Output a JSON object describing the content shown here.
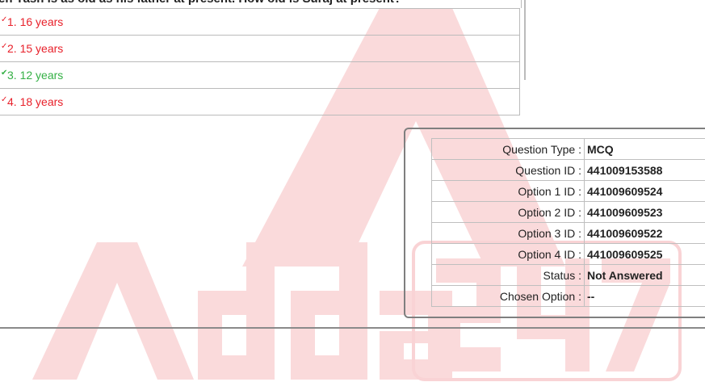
{
  "question": {
    "text": "en Yash is as old as his father at present. How old is Suraj at present?"
  },
  "options": [
    {
      "label": "1. 16 years",
      "status": "wrong",
      "mark": "✓"
    },
    {
      "label": "2. 15 years",
      "status": "wrong",
      "mark": "✓"
    },
    {
      "label": "3. 12 years",
      "status": "correct",
      "mark": "✔"
    },
    {
      "label": "4. 18 years",
      "status": "wrong",
      "mark": "✓"
    }
  ],
  "info": {
    "rows": [
      {
        "label": "Question Type :",
        "value": "MCQ"
      },
      {
        "label": "Question ID :",
        "value": "441009153588"
      },
      {
        "label": "Option 1 ID :",
        "value": "441009609524"
      },
      {
        "label": "Option 2 ID :",
        "value": "441009609523"
      },
      {
        "label": "Option 3 ID :",
        "value": "441009609522"
      },
      {
        "label": "Option 4 ID :",
        "value": "441009609525"
      },
      {
        "label": "Status :",
        "value": "Not Answered"
      },
      {
        "label": "Chosen Option :",
        "value": "--"
      }
    ]
  },
  "watermark": {
    "brand": "Adda247",
    "color": "#f6b8bb"
  }
}
